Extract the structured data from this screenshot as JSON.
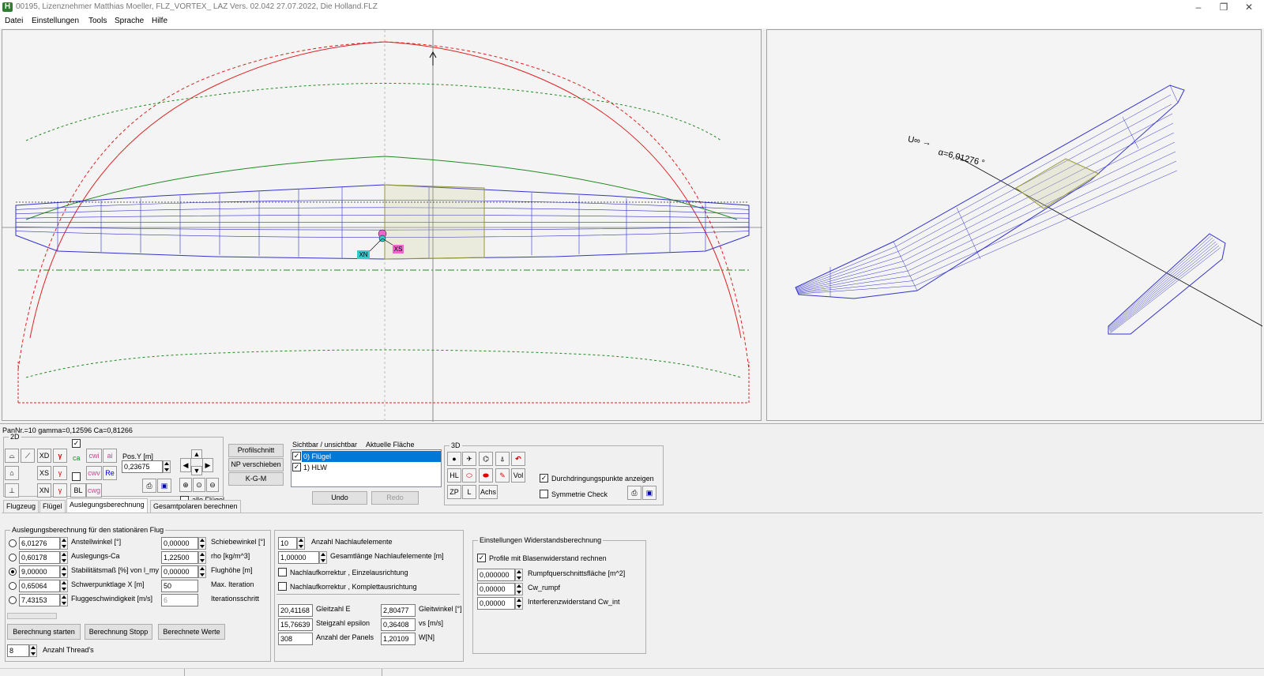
{
  "window": {
    "title": "00195, Lizenznehmer Matthias Moeller, FLZ_VORTEX_ LAZ Vers. 02.042 27.07.2022, Die Holland.FLZ",
    "app_icon": "H"
  },
  "menu": [
    "Datei",
    "Einstellungen",
    "Tools",
    "Sprache",
    "Hilfe"
  ],
  "view2d": {
    "xn_label": "XN",
    "xs_label": "XS"
  },
  "view3d": {
    "annotation_u": "U∞ →",
    "annotation_alpha": "α=6,01276 °"
  },
  "status_text": "PanNr.=10 gamma=0,12596 Ca=0,81266",
  "toolbar2d": {
    "group_label": "2D",
    "xd": "XD",
    "xs": "XS",
    "xn": "XN",
    "ca": "ca",
    "cwi": "cwi",
    "ai": "ai",
    "cwv": "cwv",
    "re": "Re",
    "bl": "BL",
    "cwg": "cwg",
    "gamma_sym": "γ",
    "posy_label": "Pos.Y [m]",
    "posy_value": "0,23675",
    "alle_fluegel": "alle Flügel"
  },
  "actions": {
    "profilschnitt": "Profilschnitt",
    "np_verschieben": "NP verschieben",
    "kgm": "K-G-M"
  },
  "visibility": {
    "header_visible": "Sichtbar / unsichtbar",
    "header_current": "Aktuelle Fläche",
    "items": [
      "0) Flügel",
      "1) HLW"
    ],
    "undo": "Undo",
    "redo": "Redo"
  },
  "toolbar3d": {
    "group_label": "3D",
    "hl": "HL",
    "vol": "Vol",
    "zp": "ZP",
    "l": "L",
    "achs": "Achs",
    "durchdringung": "Durchdringungspunkte anzeigen",
    "symmetrie": "Symmetrie Check"
  },
  "tabs": [
    "Flugzeug",
    "Flügel",
    "Auslegungsberechnung",
    "Gesamtpolaren berechnen"
  ],
  "active_tab": "Auslegungsberechnung",
  "ausl": {
    "group_label": "Auslegungsberechnung für den stationären Flug",
    "rows": [
      {
        "value": "6,01276",
        "label": "Anstellwinkel [°]"
      },
      {
        "value": "0,60178",
        "label": "Auslegungs-Ca"
      },
      {
        "value": "9,00000",
        "label": "Stabilitätsmaß [%] von l_my"
      },
      {
        "value": "0,65064",
        "label": "Schwerpunktlage X [m]"
      },
      {
        "value": "7,43153",
        "label": "Fluggeschwindigkeit [m/s]"
      }
    ],
    "rows2": [
      {
        "value": "0,00000",
        "label": "Schiebewinkel [°]"
      },
      {
        "value": "1,22500",
        "label": "rho [kg/m^3]"
      },
      {
        "value": "0,00000",
        "label": "Flughöhe [m]"
      },
      {
        "value": "50",
        "label": "Max. Iteration"
      },
      {
        "value": "6",
        "label": "Iterationsschritt"
      }
    ],
    "start": "Berechnung starten",
    "stop": "Berechnung Stopp",
    "werte": "Berechnete Werte",
    "threads_value": "8",
    "threads_label": "Anzahl Thread's"
  },
  "nachlauf": {
    "anzahl_value": "10",
    "anzahl_label": "Anzahl Nachlaufelemente",
    "laenge_value": "1,00000",
    "laenge_label": "Gesamtlänge Nachlaufelemente [m]",
    "korr1": "Nachlaufkorrektur , Einzelausrichtung",
    "korr2": "Nachlaufkorrektur , Komplettausrichtung"
  },
  "results": [
    {
      "value": "20,41168",
      "label": "Gleitzahl E"
    },
    {
      "value": "15,76639",
      "label": "Steigzahl epsilon"
    },
    {
      "value": "308",
      "label": "Anzahl der Panels"
    }
  ],
  "results2": [
    {
      "value": "2,80477",
      "label": "Gleitwinkel [°]"
    },
    {
      "value": "0,36408",
      "label": "vs [m/s]"
    },
    {
      "value": "1,20109",
      "label": "W[N]"
    }
  ],
  "widerstand": {
    "group_label": "Einstellungen Widerstandsberechnung",
    "blasen": "Profile mit Blasenwiderstand rechnen",
    "rows": [
      {
        "value": "0,000000",
        "label": "Rumpfquerschnittsfläche [m^2]"
      },
      {
        "value": "0,00000",
        "label": "Cw_rumpf"
      },
      {
        "value": "0,00000",
        "label": "Interferenzwiderstand Cw_int"
      }
    ]
  },
  "colors": {
    "mesh": "#3333cc",
    "highlight": "#999933",
    "curve_red": "#dd2222",
    "curve_green": "#228822",
    "selection": "#0078d7"
  }
}
